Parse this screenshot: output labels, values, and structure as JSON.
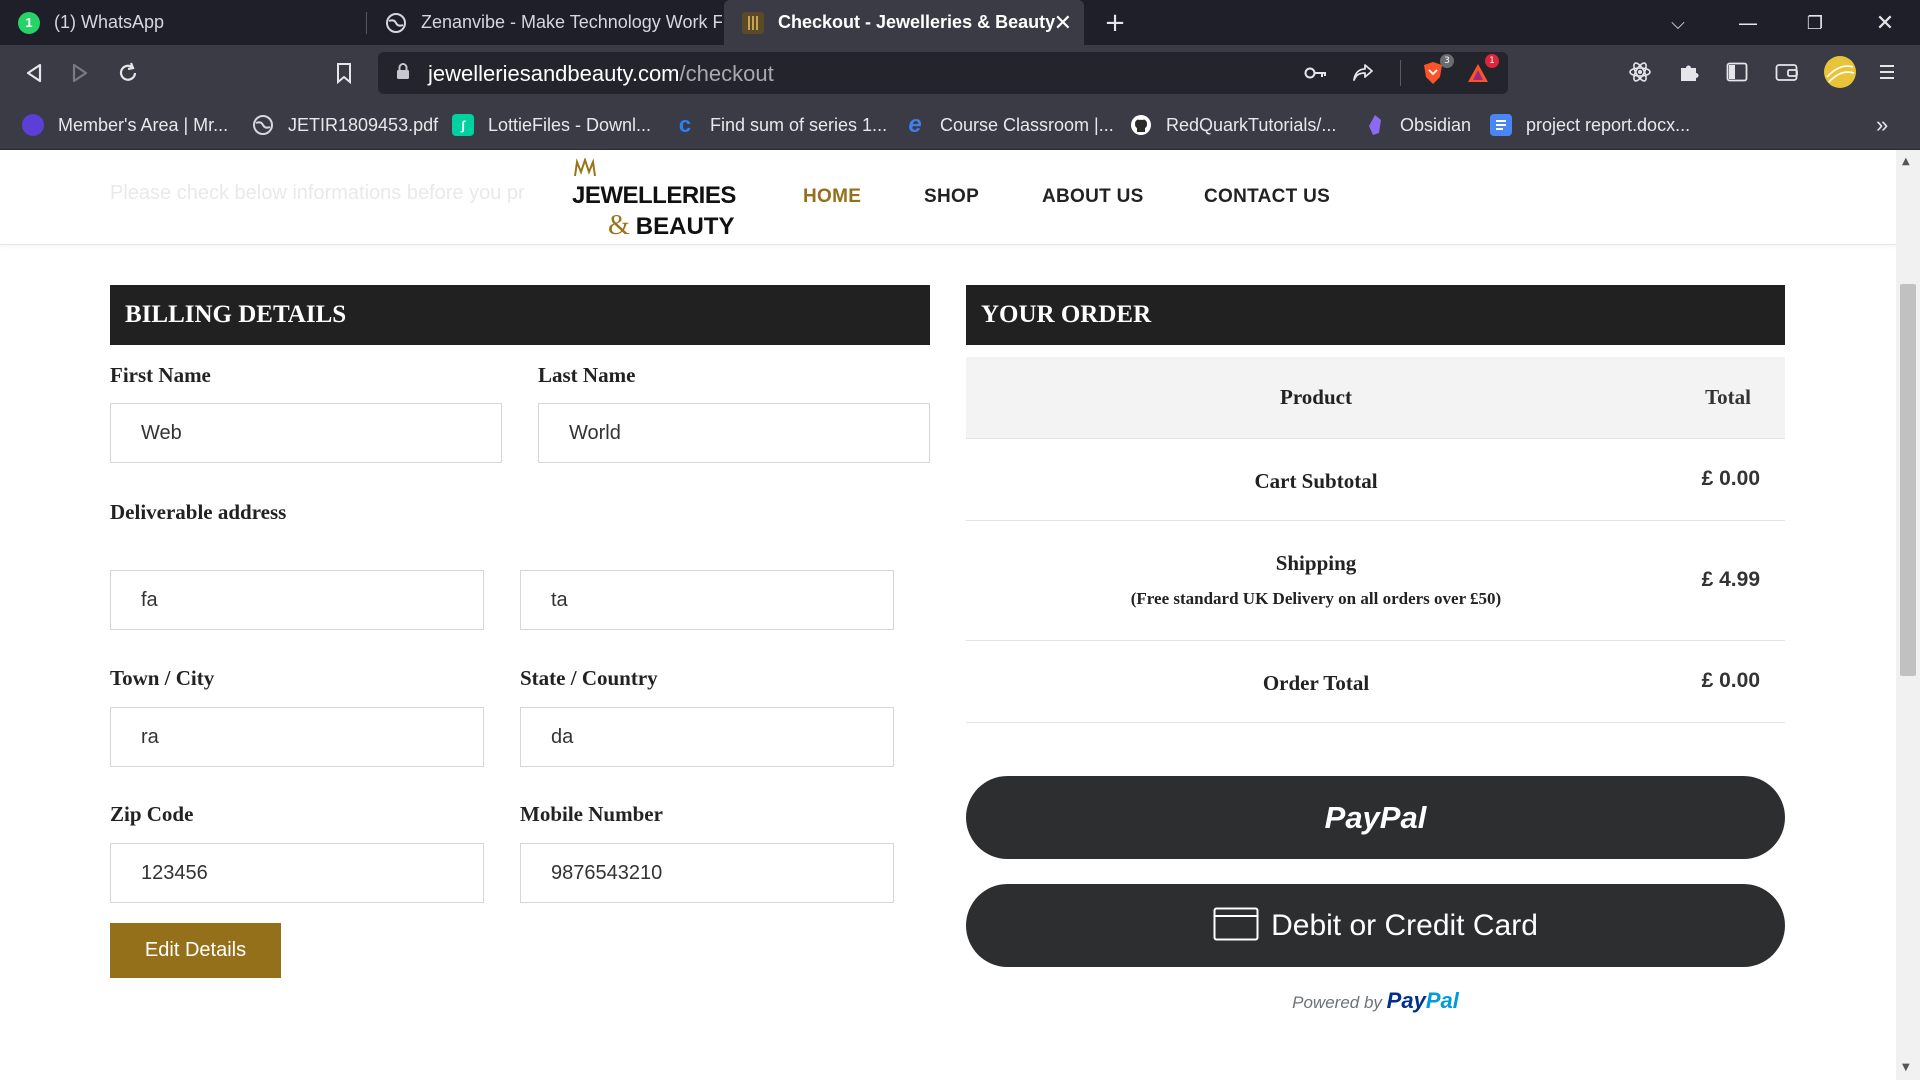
{
  "browser": {
    "tabs": [
      {
        "title": "(1) WhatsApp",
        "icon": "whatsapp-icon",
        "badge": "1",
        "active": false
      },
      {
        "title": "Zenanvibe - Make Technology Work For",
        "icon": "globe-icon",
        "active": false
      },
      {
        "title": "Checkout - Jewelleries & Beauty",
        "icon": "site-favicon",
        "active": true
      }
    ],
    "new_tab": "+",
    "url_host": "jewelleriesandbeauty.com",
    "url_path": "/checkout",
    "brave_shield_count": "3",
    "rewards_count": "1",
    "bookmarks": [
      {
        "label": "Member's Area | Mr...",
        "icon": "member-icon",
        "color": "#7a5cff"
      },
      {
        "label": "JETIR1809453.pdf",
        "icon": "globe-icon",
        "color": "#9a9aa2"
      },
      {
        "label": "LottieFiles - Downl...",
        "icon": "lottie-icon",
        "color": "#00d1a0"
      },
      {
        "label": "Find sum of series 1...",
        "icon": "c-icon",
        "color": "#2d7ff9"
      },
      {
        "label": "Course Classroom |...",
        "icon": "e-icon",
        "color": "#3f7fe6"
      },
      {
        "label": "RedQuarkTutorials/...",
        "icon": "github-icon",
        "color": "#ffffff"
      },
      {
        "label": "Obsidian",
        "icon": "obsidian-icon",
        "color": "#8b6cf0"
      },
      {
        "label": "project report.docx...",
        "icon": "docs-icon",
        "color": "#4a86f5"
      }
    ],
    "more_bookmarks": "»"
  },
  "site": {
    "faded_text": "Please check below informations before you pr",
    "logo_line1": "JEWELLERIES",
    "logo_amp": "&",
    "logo_line2": "BEAUTY",
    "nav": [
      "HOME",
      "SHOP",
      "ABOUT US",
      "CONTACT US"
    ],
    "accent": "#95701a"
  },
  "billing": {
    "heading": "BILLING DETAILS",
    "first_name_label": "First Name",
    "first_name": "Web",
    "last_name_label": "Last Name",
    "last_name": "World",
    "address_label": "Deliverable address",
    "address1": "fa",
    "address2": "ta",
    "town_label": "Town / City",
    "town": "ra",
    "state_label": "State / Country",
    "state": "da",
    "zip_label": "Zip Code",
    "zip": "123456",
    "mobile_label": "Mobile Number",
    "mobile": "9876543210",
    "edit_button": "Edit Details"
  },
  "order": {
    "heading": "YOUR ORDER",
    "col_product": "Product",
    "col_total": "Total",
    "subtotal_label": "Cart Subtotal",
    "subtotal": "£ 0.00",
    "shipping_label": "Shipping",
    "shipping_note": "(Free standard UK Delivery on all orders over £50)",
    "shipping": "£ 4.99",
    "total_label": "Order Total",
    "total": "£ 0.00"
  },
  "payment": {
    "paypal_label": "PayPal",
    "card_label": "Debit or Credit Card",
    "powered_prefix": "Powered by",
    "powered_brand_a": "Pay",
    "powered_brand_b": "Pal"
  }
}
